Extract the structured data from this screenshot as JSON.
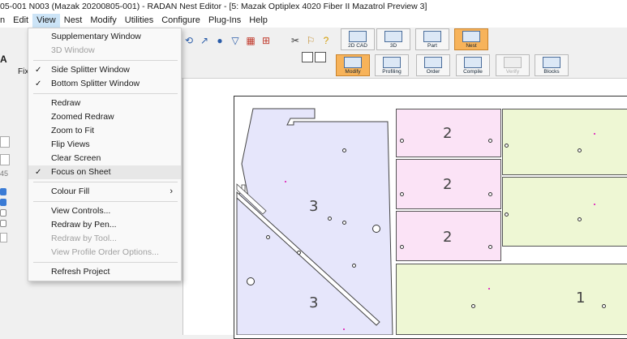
{
  "window": {
    "title": "05-001 N003 (Mazak 20200805-001) - RADAN Nest Editor - [5: Mazak Optiplex 4020 Fiber II Mazatrol Preview 3]"
  },
  "menubar": {
    "items": [
      "Edit",
      "View",
      "Nest",
      "Modify",
      "Utilities",
      "Configure",
      "Plug-Ins",
      "Help"
    ],
    "active": "View",
    "edge_glyph": "n"
  },
  "view_menu": {
    "items": [
      {
        "label": "Supplementary Window",
        "enabled": true,
        "checked": false
      },
      {
        "label": "3D Window",
        "enabled": false,
        "checked": false
      },
      {
        "label": "Side Splitter Window",
        "enabled": true,
        "checked": true
      },
      {
        "label": "Bottom Splitter Window",
        "enabled": true,
        "checked": true
      },
      {
        "label": "Redraw",
        "enabled": true,
        "checked": false
      },
      {
        "label": "Zoomed Redraw",
        "enabled": true,
        "checked": false
      },
      {
        "label": "Zoom to Fit",
        "enabled": true,
        "checked": false
      },
      {
        "label": "Flip Views",
        "enabled": true,
        "checked": false
      },
      {
        "label": "Clear Screen",
        "enabled": true,
        "checked": false
      },
      {
        "label": "Focus on Sheet",
        "enabled": true,
        "checked": true
      },
      {
        "label": "Colour Fill",
        "enabled": true,
        "checked": false,
        "submenu": true
      },
      {
        "label": "View Controls...",
        "enabled": true,
        "checked": false
      },
      {
        "label": "Redraw by Pen...",
        "enabled": true,
        "checked": false
      },
      {
        "label": "Redraw by Tool...",
        "enabled": false,
        "checked": false
      },
      {
        "label": "View Profile Order Options...",
        "enabled": false,
        "checked": false
      },
      {
        "label": "Refresh Project",
        "enabled": true,
        "checked": false
      }
    ],
    "check_glyph": "✓",
    "submenu_glyph": "›"
  },
  "mode_buttons_top": [
    {
      "label": "2D CAD",
      "icon": "2d-cad-icon",
      "state": "normal"
    },
    {
      "label": "3D",
      "icon": "3d-icon",
      "state": "normal"
    },
    {
      "label": "Part",
      "icon": "part-icon",
      "state": "normal"
    },
    {
      "label": "Nest",
      "icon": "nest-icon",
      "state": "active"
    }
  ],
  "mode_buttons_bottom": [
    {
      "label": "Modify",
      "icon": "modify-icon",
      "state": "active"
    },
    {
      "label": "Profiling",
      "icon": "profiling-icon",
      "state": "normal"
    },
    {
      "label": "Order",
      "icon": "order-icon",
      "state": "normal"
    },
    {
      "label": "Compile",
      "icon": "compile-icon",
      "state": "normal"
    },
    {
      "label": "Verify",
      "icon": "verify-icon",
      "state": "disabled"
    },
    {
      "label": "Blocks",
      "icon": "blocks-icon",
      "state": "normal"
    }
  ],
  "toolbar_icons": [
    "rotate-icon",
    "info-icon",
    "filter-icon",
    "layout-icon",
    "grid-icon",
    "scissors-icon",
    "pointer-icon",
    "help-icon"
  ],
  "left_panel": {
    "tab_label": "Fix",
    "tab_mark": "A",
    "field_value": "45"
  },
  "nest_parts": {
    "purple_labels": [
      "3",
      "3"
    ],
    "pink_labels": [
      "2",
      "2",
      "2"
    ],
    "green_labels": [
      "1"
    ]
  },
  "colors": {
    "purple_part": "#e6e6fb",
    "pink_part": "#fbe3f6",
    "green_part": "#eef7d4",
    "active_button": "#f7b35a",
    "checkbox": "#3a7bd5"
  }
}
